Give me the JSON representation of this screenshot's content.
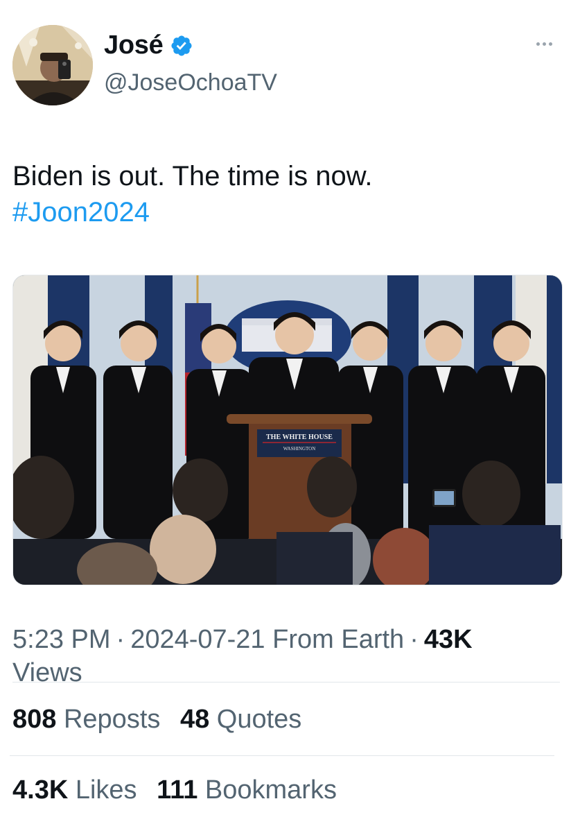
{
  "author": {
    "name": "José",
    "handle": "@JoseOchoaTV",
    "verified": true
  },
  "tweet": {
    "text": "Biden is out. The time is now.",
    "hashtag": "#Joon2024",
    "media": {
      "podium_sign": "THE WHITE HOUSE",
      "podium_sub": "WASHINGTON"
    }
  },
  "meta": {
    "time": "5:23 PM",
    "date": "2024-07-21",
    "source": "From Earth",
    "views_count": "43K",
    "views_label": "Views"
  },
  "stats": {
    "reposts_count": "808",
    "reposts_label": "Reposts",
    "quotes_count": "48",
    "quotes_label": "Quotes",
    "likes_count": "4.3K",
    "likes_label": "Likes",
    "bookmarks_count": "111",
    "bookmarks_label": "Bookmarks"
  },
  "colors": {
    "accent": "#1d9bf0",
    "muted": "#536471",
    "text": "#0f1419"
  }
}
